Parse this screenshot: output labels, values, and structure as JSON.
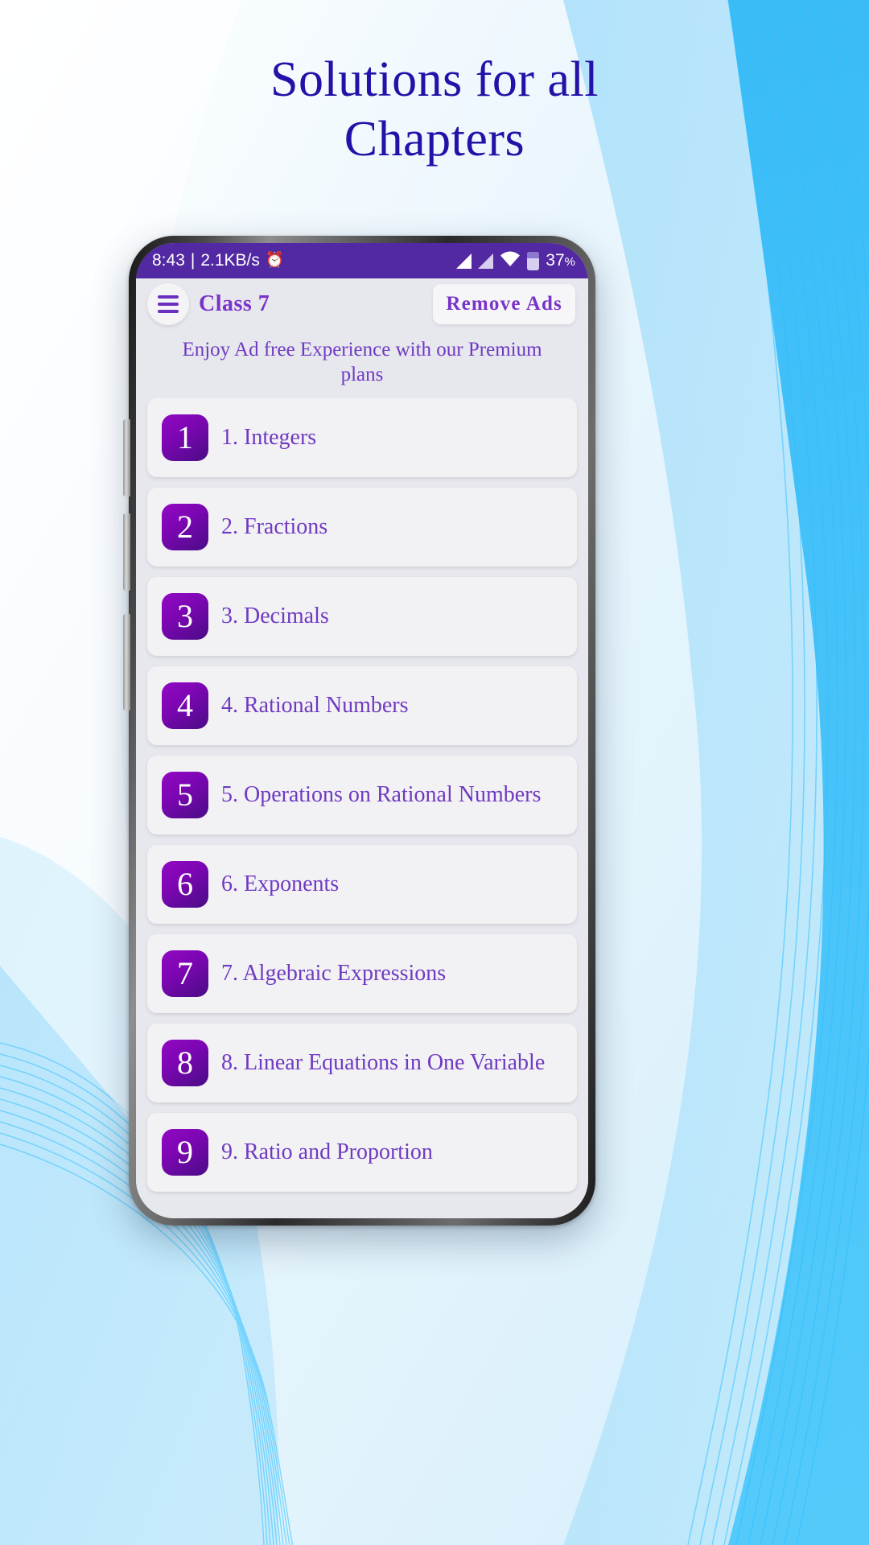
{
  "headline": {
    "line1": "Solutions for all",
    "line2": "Chapters"
  },
  "theme": {
    "headline_color": "#2311a8",
    "status_bar_color": "#5229a3",
    "accent_purple": "#7a33c9",
    "badge_gradient_from": "#9208c4",
    "badge_gradient_to": "#4a0c86",
    "screen_bg": "#e7e7ee",
    "card_bg": "#f2f2f4",
    "background_wave_color": "#29b6f6"
  },
  "status_bar": {
    "time": "8:43",
    "separator": "|",
    "network_speed": "2.1KB/s",
    "alarm_icon": "alarm-clock-icon",
    "signal_icon_1": "signal-bars-icon",
    "signal_icon_2": "signal-bars-icon",
    "wifi_icon": "wifi-icon",
    "battery_icon": "battery-icon",
    "battery_level": "37",
    "battery_percent_symbol": "%",
    "battery_fill_ratio": 0.37
  },
  "app_bar": {
    "menu_icon": "hamburger-menu-icon",
    "title": "Class  7",
    "remove_ads_label": "Remove Ads"
  },
  "premium_banner": {
    "text": "Enjoy Ad free Experience with our Premium plans"
  },
  "chapters": [
    {
      "number": "1",
      "title": "1. Integers"
    },
    {
      "number": "2",
      "title": "2. Fractions"
    },
    {
      "number": "3",
      "title": "3. Decimals"
    },
    {
      "number": "4",
      "title": "4. Rational Numbers"
    },
    {
      "number": "5",
      "title": "5. Operations on Rational Numbers"
    },
    {
      "number": "6",
      "title": "6. Exponents"
    },
    {
      "number": "7",
      "title": "7. Algebraic Expressions"
    },
    {
      "number": "8",
      "title": "8. Linear Equations in One Variable"
    },
    {
      "number": "9",
      "title": "9. Ratio and Proportion"
    }
  ],
  "device": {
    "volume_up_button": "volume-up-button",
    "volume_down_button": "volume-down-button",
    "power_button": "power-button"
  }
}
